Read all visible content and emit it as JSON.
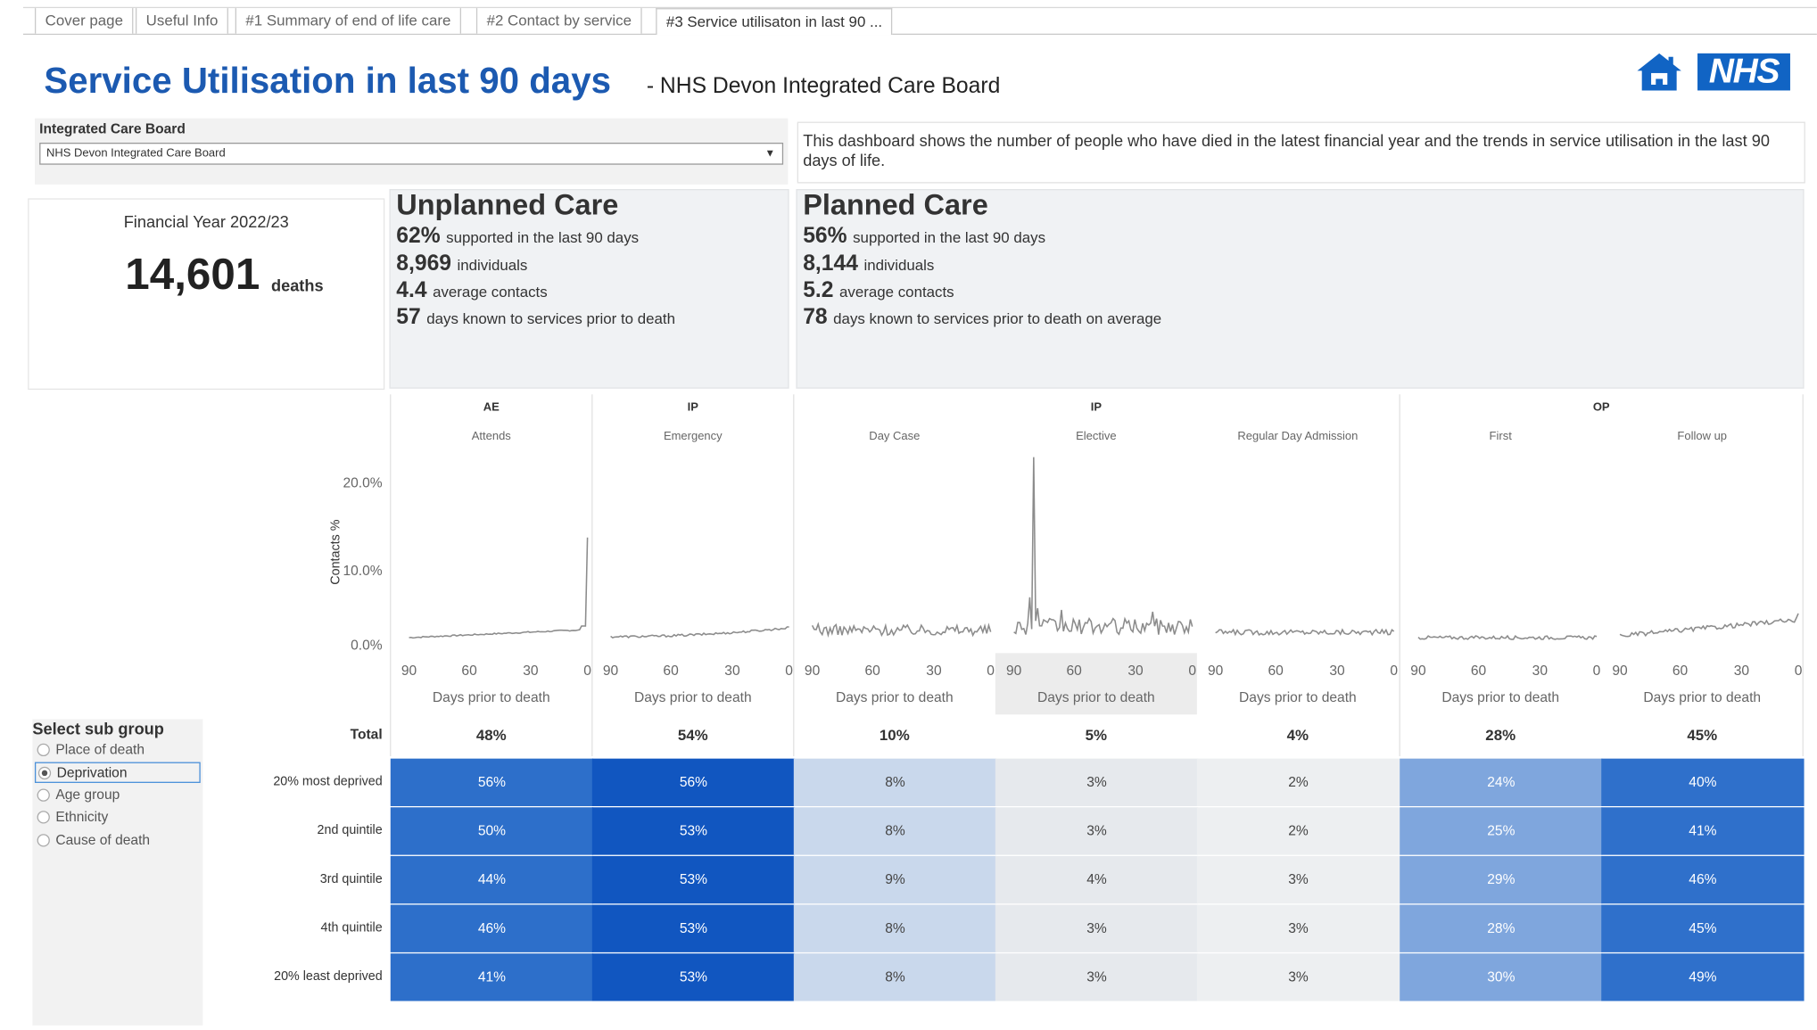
{
  "tabs": [
    {
      "label": "Cover page"
    },
    {
      "label": "Useful Info"
    },
    {
      "label": "#1 Summary of end of life care"
    },
    {
      "label": "#2 Contact by service"
    },
    {
      "label": "#3 Service utilisaton in last 90 ..."
    }
  ],
  "header": {
    "title": "Service Utilisation in last 90 days",
    "subtitle": "- NHS Devon Integrated Care Board",
    "nhs_logo": "NHS",
    "home_icon": "home-icon"
  },
  "filter": {
    "label": "Integrated Care Board",
    "value": "NHS Devon Integrated Care Board"
  },
  "description": "This dashboard shows the number of people who have died in the latest financial year and the trends in service utilisation in the last 90 days of life.",
  "financial_year": {
    "label": "Financial Year 2022/23",
    "deaths": "14,601",
    "deaths_unit": "deaths"
  },
  "unplanned": {
    "title": "Unplanned Care",
    "stats": [
      {
        "value": "62%",
        "text": "supported in the last 90 days"
      },
      {
        "value": "8,969",
        "text": "individuals"
      },
      {
        "value": "4.4",
        "text": "average contacts"
      },
      {
        "value": "57",
        "text": "days known to services prior to death"
      }
    ]
  },
  "planned": {
    "title": "Planned Care",
    "stats": [
      {
        "value": "56%",
        "text": "supported in the last 90 days"
      },
      {
        "value": "8,144",
        "text": "individuals"
      },
      {
        "value": "5.2",
        "text": "average contacts"
      },
      {
        "value": "78",
        "text": "days known to services prior to death on average"
      }
    ]
  },
  "chart": {
    "ylabel": "Contacts %",
    "yticks": [
      "20.0%",
      "10.0%",
      "0.0%"
    ],
    "xticks": [
      "90",
      "60",
      "30",
      "0"
    ],
    "xlabel": "Days prior to death"
  },
  "chart_data": {
    "type": "line",
    "x_range": [
      90,
      0
    ],
    "xlabel": "Days prior to death",
    "ylabel": "Contacts %",
    "ylim": [
      0,
      20
    ],
    "y_unit": "%",
    "groups": [
      {
        "label": "AE",
        "span": [
          0,
          0
        ]
      },
      {
        "label": "IP",
        "span": [
          1,
          1
        ]
      },
      {
        "label": "IP",
        "span": [
          2,
          4
        ]
      },
      {
        "label": "OP",
        "span": [
          5,
          6
        ]
      }
    ],
    "panels": [
      {
        "name": "Attends",
        "shape": "ae",
        "peak": 11.5,
        "base": 0.3
      },
      {
        "name": "Emergency",
        "shape": "rise",
        "peak": 1.5,
        "base": 0.4
      },
      {
        "name": "Day Case",
        "shape": "noisy",
        "peak": 1.8,
        "base": 0.9
      },
      {
        "name": "Elective",
        "shape": "spike",
        "peak": 20.5,
        "base": 1.0
      },
      {
        "name": "Regular Day Admission",
        "shape": "flat",
        "peak": 1.0,
        "base": 0.9
      },
      {
        "name": "First",
        "shape": "flatlow",
        "peak": 0.6,
        "base": 0.3
      },
      {
        "name": "Follow up",
        "shape": "rise2",
        "peak": 3.0,
        "base": 0.5
      }
    ]
  },
  "table": {
    "total_label": "Total",
    "totals": [
      "48%",
      "54%",
      "10%",
      "5%",
      "4%",
      "28%",
      "45%"
    ],
    "rows": [
      {
        "label": "20% most deprived",
        "values": [
          "56%",
          "56%",
          "8%",
          "3%",
          "2%",
          "24%",
          "40%"
        ]
      },
      {
        "label": "2nd quintile",
        "values": [
          "50%",
          "53%",
          "8%",
          "3%",
          "2%",
          "25%",
          "41%"
        ]
      },
      {
        "label": "3rd quintile",
        "values": [
          "44%",
          "53%",
          "9%",
          "4%",
          "3%",
          "29%",
          "46%"
        ]
      },
      {
        "label": "4th quintile",
        "values": [
          "46%",
          "53%",
          "8%",
          "3%",
          "3%",
          "28%",
          "45%"
        ]
      },
      {
        "label": "20% least deprived",
        "values": [
          "41%",
          "53%",
          "8%",
          "3%",
          "3%",
          "30%",
          "49%"
        ]
      }
    ],
    "colors": [
      "#2d6fca",
      "#1156c0",
      "#c9d8ec",
      "#e6e9ed",
      "#edeff1",
      "#7fa6dd",
      "#2f70cb"
    ]
  },
  "subgroup": {
    "title": "Select sub group",
    "options": [
      {
        "label": "Place of death",
        "selected": false
      },
      {
        "label": "Deprivation",
        "selected": true
      },
      {
        "label": "Age group",
        "selected": false
      },
      {
        "label": "Ethnicity",
        "selected": false
      },
      {
        "label": "Cause of death",
        "selected": false
      }
    ]
  }
}
